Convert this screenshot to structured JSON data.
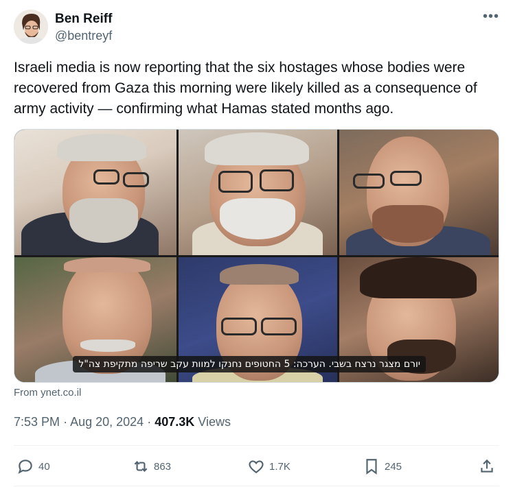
{
  "author": {
    "name": "Ben Reiff",
    "handle": "@bentreyf"
  },
  "more_label": "•••",
  "tweet": {
    "text": "Israeli media is now reporting that the six hostages whose bodies were recovered from Gaza this morning were likely killed as a consequence of army activity — confirming what Hamas stated months ago."
  },
  "media": {
    "caption": "יורם מצגר נרצח בשבי. הערכה: 5 החטופים נחנקו למוות עקב שריפה מתקיפת צה\"ל",
    "source": "From ynet.co.il"
  },
  "meta": {
    "time": "7:53 PM",
    "date": "Aug 20, 2024",
    "views_count": "407.3K",
    "views_label": "Views"
  },
  "actions": {
    "replies": "40",
    "reposts": "863",
    "likes": "1.7K",
    "bookmarks": "245"
  },
  "colors": {
    "text": "#0f1419",
    "secondary": "#536471",
    "border": "#eff3f4"
  }
}
